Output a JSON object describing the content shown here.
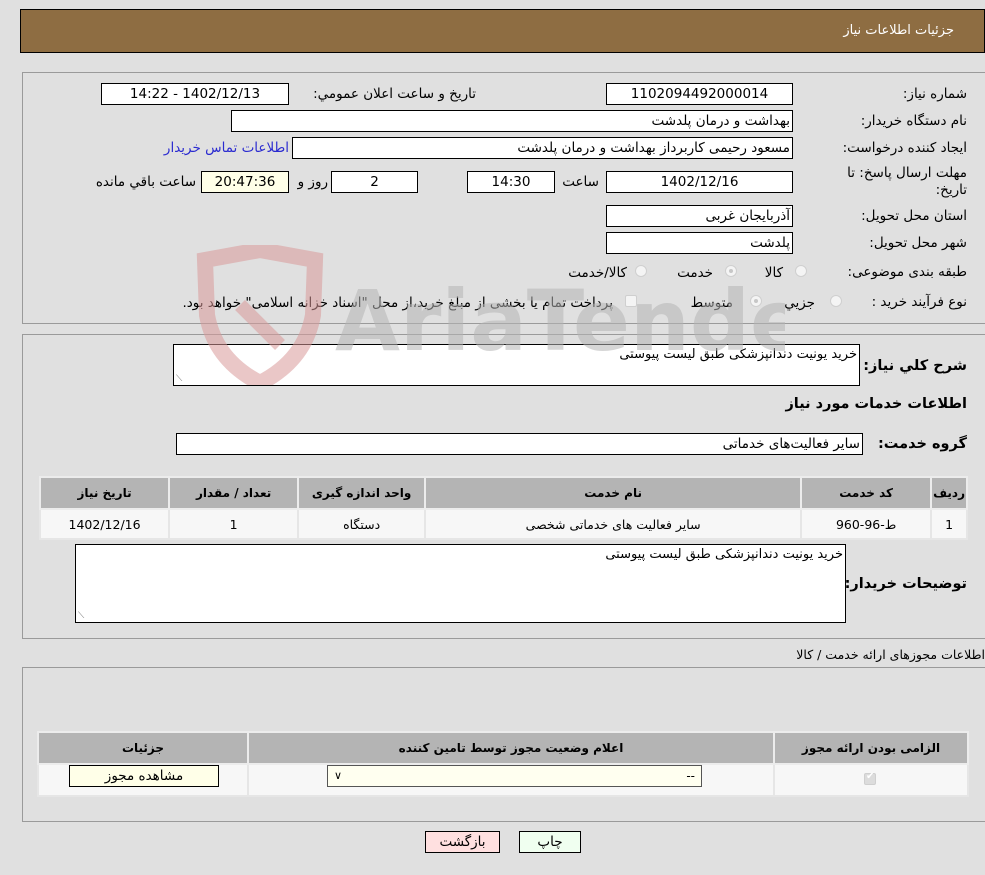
{
  "header": {
    "title": "جزئیات اطلاعات نیاز"
  },
  "details": {
    "need_number_label": "شماره نیاز:",
    "need_number": "1102094492000014",
    "announce_label": "تاریخ و ساعت اعلان عمومي:",
    "announce_value": "1402/12/13 - 14:22",
    "buyer_org_label": "نام دستگاه خریدار:",
    "buyer_org": "بهداشت و درمان پلدشت",
    "creator_label": "ایجاد کننده درخواست:",
    "creator": "مسعود رحیمی کاربرداز بهداشت و درمان پلدشت",
    "contact_link": "اطلاعات تماس خریدار",
    "deadline_label_line1": "مهلت ارسال پاسخ: تا",
    "deadline_label_line2": "تاریخ:",
    "deadline_date": "1402/12/16",
    "time_label": "ساعت",
    "deadline_time": "14:30",
    "days_value": "2",
    "days_label": "روز و",
    "remaining_time": "20:47:36",
    "remaining_label": "ساعت باقي مانده",
    "province_label": "استان محل تحویل:",
    "province": "آذربایجان غربی",
    "city_label": "شهر محل تحویل:",
    "city": "پلدشت",
    "category_label": "طبقه بندی موضوعی:",
    "category_options": [
      {
        "label": "کالا",
        "selected": false
      },
      {
        "label": "خدمت",
        "selected": true
      },
      {
        "label": "کالا/خدمت",
        "selected": false
      }
    ],
    "process_label": "نوع فرآیند خرید :",
    "process_options": [
      {
        "label": "جزيي",
        "selected": false
      },
      {
        "label": "متوسط",
        "selected": true
      }
    ],
    "treasury_note": "پرداخت تمام یا بخشی از مبلغ خرید،از محل \"اسناد خزانه اسلامی\" خواهد بود."
  },
  "description": {
    "label": "شرح کلي نیاز:",
    "value": "خرید یونیت دندانپزشکی طبق لیست پیوستی"
  },
  "services": {
    "section_title": "اطلاعات خدمات مورد نیاز",
    "group_label": "گروه خدمت:",
    "group_value": "سایر فعالیت‌های خدماتی",
    "columns": [
      "ردیف",
      "کد خدمت",
      "نام خدمت",
      "واحد اندازه گیری",
      "تعداد / مقدار",
      "تاریخ نیاز"
    ],
    "rows": [
      [
        "1",
        "ط-96-960",
        "سایر فعالیت های خدماتی شخصی",
        "دستگاه",
        "1",
        "1402/12/16"
      ]
    ]
  },
  "buyer_notes": {
    "label": "توضیحات خریدار:",
    "value": "خرید یونیت دندانپزشکی طبق لیست پیوستی"
  },
  "permits": {
    "section_title": "اطلاعات مجوزهای ارائه خدمت / کالا",
    "columns": [
      "الزامی بودن ارائه مجوز",
      "اعلام وضعیت مجوز توسط تامین کننده",
      "جزئیات"
    ],
    "row": {
      "required": true,
      "status_value": "--",
      "view_button": "مشاهده مجوز"
    }
  },
  "footer": {
    "print_button": "چاپ",
    "back_button": "بازگشت"
  },
  "watermark": {
    "text": "AriaTender.neT"
  }
}
